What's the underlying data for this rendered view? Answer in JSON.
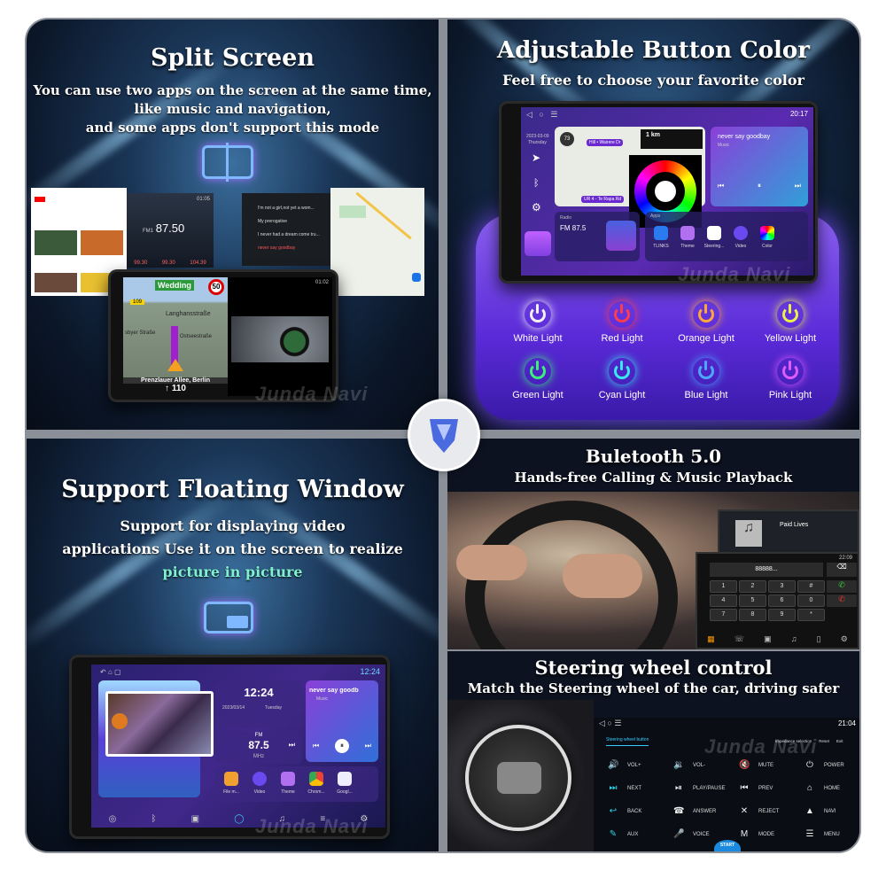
{
  "brand_watermark": "Junda Navi",
  "split_screen": {
    "title": "Split Screen",
    "lines": [
      "You can use two apps on the screen at the same time,",
      "like music and navigation,",
      "and some apps don't support this mode"
    ],
    "radio": {
      "freq": "87.50",
      "time": "01:05",
      "band": "FM1",
      "presets": [
        "99.30",
        "99.30",
        "104.39"
      ]
    },
    "playlist": [
      "I'm not a girl,not yet a wom...",
      "My prerogative",
      "I never had a dream come tru...",
      "never say goodbay"
    ],
    "nav": {
      "sign": "Wedding",
      "speed_limit": "50",
      "route": "109",
      "streets": [
        "Langhansstraße",
        "Ostseestraße",
        "sbyer Straße"
      ],
      "location": "Prenzlauer Allee, Berlin",
      "distance": "110",
      "time": "01:02"
    }
  },
  "button_color": {
    "title": "Adjustable Button Color",
    "subtitle": "Feel free to choose your favorite color",
    "screen": {
      "time": "20:17",
      "date": "2023-03-09",
      "day": "Thursday",
      "nav_distance": "1 km",
      "nav_speed": "73",
      "route": "Hill • Wairere Dr",
      "direction": "UR 4 - Te Rapa Rd",
      "song": "never say goodbay",
      "song_sub": "Music",
      "radio_label": "Radio",
      "radio_freq": "FM 87.5",
      "apps_label": "Apps",
      "apps": [
        "TLINKS",
        "Theme",
        "Steering...",
        "Video",
        "Color"
      ]
    },
    "lights": [
      {
        "label": "White Light",
        "color": "#f2f2f2"
      },
      {
        "label": "Red Light",
        "color": "#ff3b4e"
      },
      {
        "label": "Orange Light",
        "color": "#ffa63a"
      },
      {
        "label": "Yellow Light",
        "color": "#e8f04a"
      },
      {
        "label": "Green Light",
        "color": "#3cf07a"
      },
      {
        "label": "Cyan Light",
        "color": "#3ae8f0"
      },
      {
        "label": "Blue Light",
        "color": "#4aa8ff"
      },
      {
        "label": "Pink Light",
        "color": "#e05cff"
      }
    ]
  },
  "floating_window": {
    "title": "Support Floating Window",
    "lines": [
      "Support for displaying video",
      "applications Use it on the screen to realize"
    ],
    "highlight": "picture in picture",
    "highlight_color": "#7ff0d0",
    "screen": {
      "time": "12:24",
      "clock": "12:24",
      "date": "2023/03/14",
      "day": "Tuesday",
      "fm_label": "FM",
      "fm_freq": "87.5",
      "fm_unit": "MHz",
      "song": "never say goodb",
      "song_sub": "Music",
      "apps": [
        "File m...",
        "Video",
        "Theme",
        "Chrom...",
        "Googl..."
      ]
    }
  },
  "bluetooth": {
    "title": "Buletooth 5.0",
    "subtitle": "Hands-free Calling & Music Playback",
    "dial_display": "88888...",
    "keys": [
      "1",
      "2",
      "3",
      "#",
      "4",
      "5",
      "6",
      "0",
      "7",
      "8",
      "9",
      "*"
    ],
    "track": "Paid Lives",
    "time": "22:09"
  },
  "steering": {
    "title": "Steering wheel control",
    "subtitle": "Match the Steering wheel of the car, driving safer",
    "screen": {
      "time": "21:04",
      "tab": "Steering wheel button",
      "impedance": "Impedance selection",
      "reset": "Reset",
      "exit": "Exit",
      "start": "START",
      "buttons": [
        {
          "label": "VOL+",
          "glyph": "🔊"
        },
        {
          "label": "VOL-",
          "glyph": "🔉"
        },
        {
          "label": "MUTE",
          "glyph": "🔇"
        },
        {
          "label": "POWER",
          "glyph": "⏻"
        },
        {
          "label": "NEXT",
          "glyph": "⏭"
        },
        {
          "label": "PLAY/PAUSE",
          "glyph": "⏯"
        },
        {
          "label": "PREV",
          "glyph": "⏮"
        },
        {
          "label": "HOME",
          "glyph": "⌂"
        },
        {
          "label": "BACK",
          "glyph": "↩"
        },
        {
          "label": "ANSWER",
          "glyph": "☎"
        },
        {
          "label": "REJECT",
          "glyph": "✕"
        },
        {
          "label": "NAVI",
          "glyph": "▲"
        },
        {
          "label": "AUX",
          "glyph": "✎"
        },
        {
          "label": "VOICE",
          "glyph": "🎤"
        },
        {
          "label": "MODE",
          "glyph": "M"
        },
        {
          "label": "MENU",
          "glyph": "☰"
        }
      ]
    }
  }
}
